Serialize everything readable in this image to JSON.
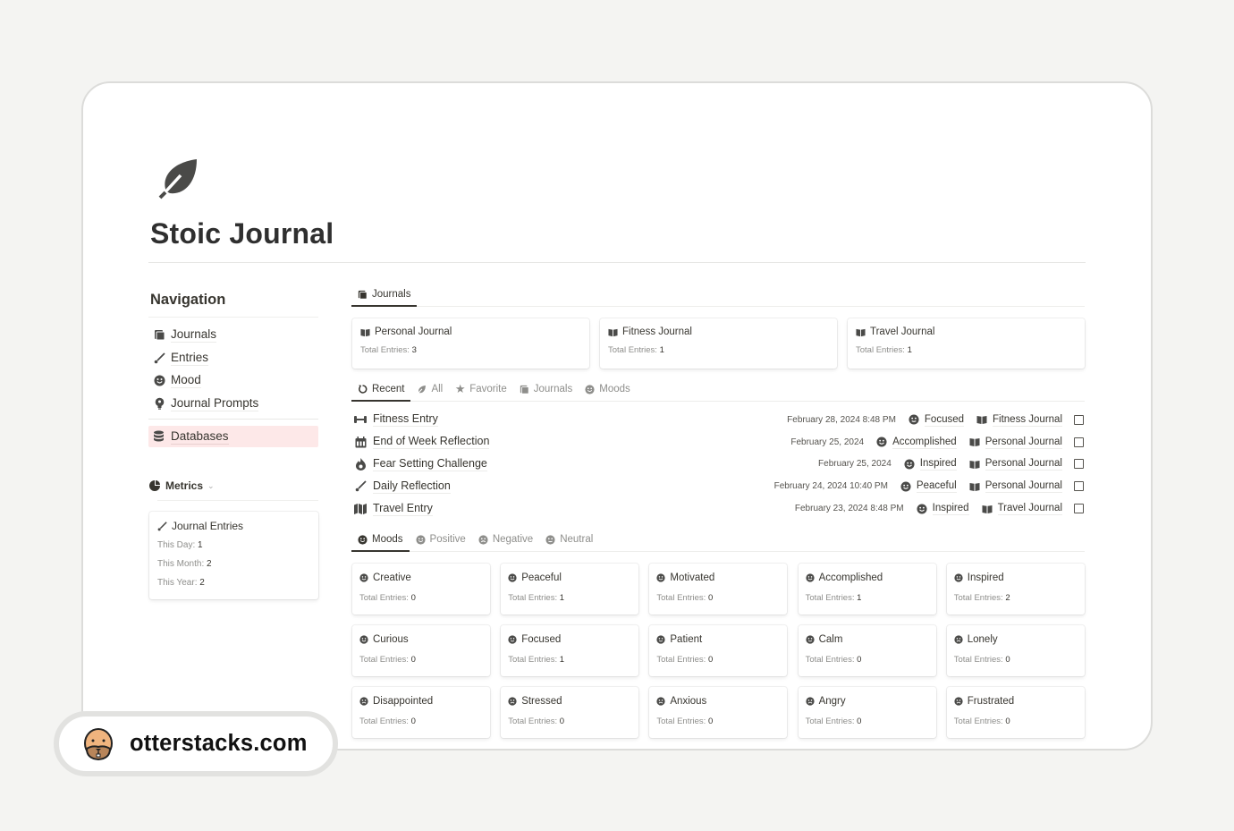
{
  "page": {
    "icon": "leaf-icon",
    "title": "Stoic Journal"
  },
  "sidebar": {
    "heading": "Navigation",
    "items": [
      {
        "label": "Journals",
        "icon": "book-icon"
      },
      {
        "label": "Entries",
        "icon": "brush-icon"
      },
      {
        "label": "Mood",
        "icon": "smiley-icon"
      },
      {
        "label": "Journal Prompts",
        "icon": "lightbulb-icon"
      }
    ],
    "databases": {
      "label": "Databases",
      "icon": "database-icon",
      "highlight": "#fde8e8"
    },
    "metrics": {
      "label": "Metrics",
      "icon": "pie-chart-icon",
      "card": {
        "title": "Journal Entries",
        "icon": "brush-icon",
        "rows": [
          {
            "label": "This Day: ",
            "value": "1"
          },
          {
            "label": "This Month: ",
            "value": "2"
          },
          {
            "label": "This Year: ",
            "value": "2"
          }
        ]
      }
    }
  },
  "journals_section": {
    "tab": {
      "label": "Journals",
      "icon": "book-icon"
    },
    "cards": [
      {
        "title": "Personal Journal",
        "sub_label": "Total Entries: ",
        "count": "3"
      },
      {
        "title": "Fitness Journal",
        "sub_label": "Total Entries: ",
        "count": "1"
      },
      {
        "title": "Travel Journal",
        "sub_label": "Total Entries: ",
        "count": "1"
      }
    ]
  },
  "entries_section": {
    "tabs": [
      {
        "label": "Recent",
        "icon": "refresh-icon",
        "active": true
      },
      {
        "label": "All",
        "icon": "leaf-icon",
        "active": false
      },
      {
        "label": "Favorite",
        "icon": "star-icon",
        "active": false
      },
      {
        "label": "Journals",
        "icon": "book-icon",
        "active": false
      },
      {
        "label": "Moods",
        "icon": "smiley-icon",
        "active": false
      }
    ],
    "rows": [
      {
        "name": "Fitness Entry",
        "icon": "dumbbell-icon",
        "date": "February 28, 2024 8:48 PM",
        "mood": "Focused",
        "journal": "Fitness Journal",
        "checked": false
      },
      {
        "name": "End of Week Reflection",
        "icon": "calendar-icon",
        "date": "February 25, 2024",
        "mood": "Accomplished",
        "journal": "Personal Journal",
        "checked": false
      },
      {
        "name": "Fear Setting Challenge",
        "icon": "fire-icon",
        "date": "February 25, 2024",
        "mood": "Inspired",
        "journal": "Personal Journal",
        "checked": false
      },
      {
        "name": "Daily Reflection",
        "icon": "brush-icon",
        "date": "February 24, 2024 10:40 PM",
        "mood": "Peaceful",
        "journal": "Personal Journal",
        "checked": false
      },
      {
        "name": "Travel Entry",
        "icon": "map-icon",
        "date": "February 23, 2024 8:48 PM",
        "mood": "Inspired",
        "journal": "Travel Journal",
        "checked": false
      }
    ]
  },
  "moods_section": {
    "tabs": [
      {
        "label": "Moods",
        "active": true
      },
      {
        "label": "Positive",
        "active": false
      },
      {
        "label": "Negative",
        "active": false
      },
      {
        "label": "Neutral",
        "active": false
      }
    ],
    "sub_label": "Total Entries: ",
    "cards": [
      {
        "name": "Creative",
        "count": "0",
        "face": "happy"
      },
      {
        "name": "Peaceful",
        "count": "1",
        "face": "happy"
      },
      {
        "name": "Motivated",
        "count": "0",
        "face": "happy"
      },
      {
        "name": "Accomplished",
        "count": "1",
        "face": "happy"
      },
      {
        "name": "Inspired",
        "count": "2",
        "face": "happy"
      },
      {
        "name": "Curious",
        "count": "0",
        "face": "happy"
      },
      {
        "name": "Focused",
        "count": "1",
        "face": "neutral"
      },
      {
        "name": "Patient",
        "count": "0",
        "face": "neutral"
      },
      {
        "name": "Calm",
        "count": "0",
        "face": "neutral"
      },
      {
        "name": "Lonely",
        "count": "0",
        "face": "sad"
      },
      {
        "name": "Disappointed",
        "count": "0",
        "face": "sad"
      },
      {
        "name": "Stressed",
        "count": "0",
        "face": "sad"
      },
      {
        "name": "Anxious",
        "count": "0",
        "face": "sad"
      },
      {
        "name": "Angry",
        "count": "0",
        "face": "sad"
      },
      {
        "name": "Frustrated",
        "count": "0",
        "face": "sad"
      }
    ]
  },
  "badge": {
    "text": "otterstacks.com",
    "icon": "otter-icon"
  }
}
